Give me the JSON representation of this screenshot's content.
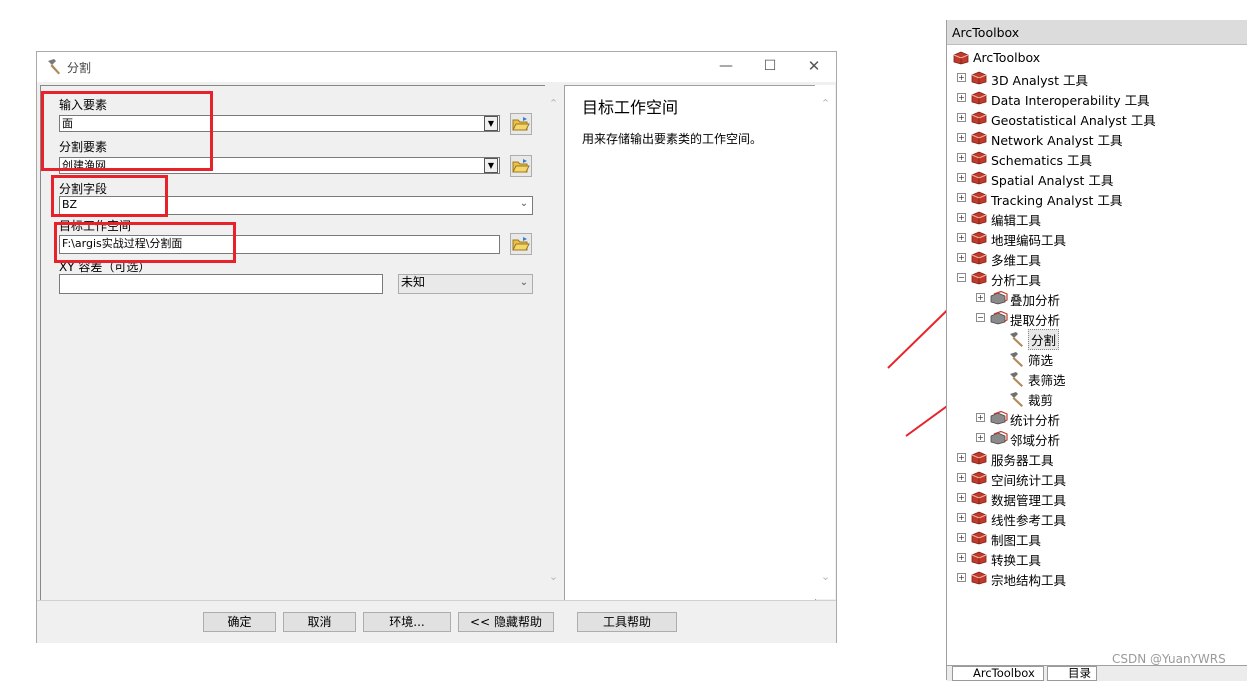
{
  "dialog": {
    "title": "分割",
    "input_features_label": "输入要素",
    "input_features_value": "面",
    "split_features_label": "分割要素",
    "split_features_value": "创建渔网",
    "split_field_label": "分割字段",
    "split_field_value": "BZ",
    "target_workspace_label": "目标工作空间",
    "target_workspace_value": "F:\\argis实战过程\\分割面",
    "xy_tolerance_label": "XY 容差（可选）",
    "xy_tolerance_value": "",
    "xy_unit_value": "未知",
    "help_title": "目标工作空间",
    "help_text": "用来存储输出要素类的工作空间。",
    "buttons": {
      "ok": "确定",
      "cancel": "取消",
      "environments": "环境...",
      "hide_help": "<< 隐藏帮助",
      "tool_help": "工具帮助"
    }
  },
  "toolbox": {
    "header": "ArcToolbox",
    "items": [
      {
        "label": "ArcToolbox",
        "level": 0,
        "expander": "",
        "icon": "toolbox-icon"
      },
      {
        "label": "3D Analyst 工具",
        "level": 1,
        "expander": "+",
        "icon": "toolbox-icon"
      },
      {
        "label": "Data Interoperability 工具",
        "level": 1,
        "expander": "+",
        "icon": "toolbox-icon"
      },
      {
        "label": "Geostatistical Analyst 工具",
        "level": 1,
        "expander": "+",
        "icon": "toolbox-icon"
      },
      {
        "label": "Network Analyst 工具",
        "level": 1,
        "expander": "+",
        "icon": "toolbox-icon"
      },
      {
        "label": "Schematics 工具",
        "level": 1,
        "expander": "+",
        "icon": "toolbox-icon"
      },
      {
        "label": "Spatial Analyst 工具",
        "level": 1,
        "expander": "+",
        "icon": "toolbox-icon"
      },
      {
        "label": "Tracking Analyst 工具",
        "level": 1,
        "expander": "+",
        "icon": "toolbox-icon"
      },
      {
        "label": "编辑工具",
        "level": 1,
        "expander": "+",
        "icon": "toolbox-icon"
      },
      {
        "label": "地理编码工具",
        "level": 1,
        "expander": "+",
        "icon": "toolbox-icon"
      },
      {
        "label": "多维工具",
        "level": 1,
        "expander": "+",
        "icon": "toolbox-icon"
      },
      {
        "label": "分析工具",
        "level": 1,
        "expander": "-",
        "icon": "toolbox-icon"
      },
      {
        "label": "叠加分析",
        "level": 2,
        "expander": "+",
        "icon": "toolset-icon"
      },
      {
        "label": "提取分析",
        "level": 2,
        "expander": "-",
        "icon": "toolset-icon"
      },
      {
        "label": "分割",
        "level": 3,
        "expander": "",
        "icon": "hammer-icon",
        "selected": true
      },
      {
        "label": "筛选",
        "level": 3,
        "expander": "",
        "icon": "hammer-icon"
      },
      {
        "label": "表筛选",
        "level": 3,
        "expander": "",
        "icon": "hammer-icon"
      },
      {
        "label": "裁剪",
        "level": 3,
        "expander": "",
        "icon": "hammer-icon"
      },
      {
        "label": "统计分析",
        "level": 2,
        "expander": "+",
        "icon": "toolset-icon"
      },
      {
        "label": "邻域分析",
        "level": 2,
        "expander": "+",
        "icon": "toolset-icon"
      },
      {
        "label": "服务器工具",
        "level": 1,
        "expander": "+",
        "icon": "toolbox-icon"
      },
      {
        "label": "空间统计工具",
        "level": 1,
        "expander": "+",
        "icon": "toolbox-icon"
      },
      {
        "label": "数据管理工具",
        "level": 1,
        "expander": "+",
        "icon": "toolbox-icon"
      },
      {
        "label": "线性参考工具",
        "level": 1,
        "expander": "+",
        "icon": "toolbox-icon"
      },
      {
        "label": "制图工具",
        "level": 1,
        "expander": "+",
        "icon": "toolbox-icon"
      },
      {
        "label": "转换工具",
        "level": 1,
        "expander": "+",
        "icon": "toolbox-icon"
      },
      {
        "label": "宗地结构工具",
        "level": 1,
        "expander": "+",
        "icon": "toolbox-icon"
      }
    ],
    "tabs": [
      "ArcToolbox",
      "目录"
    ]
  },
  "watermark": "CSDN @YuanYWRS",
  "colors": {
    "annotation_red": "#e8222a",
    "toolbox_red": "#c0392b"
  }
}
